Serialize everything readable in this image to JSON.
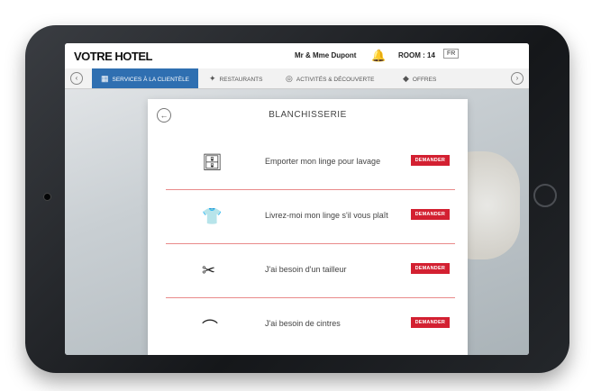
{
  "app": {
    "logo": "VOTRE HOTEL",
    "guest_name": "Mr & Mme Dupont",
    "room": "ROOM : 14",
    "language": "FR"
  },
  "nav": {
    "tabs": [
      {
        "label": "SERVICES À LA CLIENTÈLE",
        "icon": "building-icon"
      },
      {
        "label": "RESTAURANTS",
        "icon": "cutlery-icon"
      },
      {
        "label": "ACTIVITÉS & DÉCOUVERTE",
        "icon": "binoculars-icon"
      },
      {
        "label": "OFFRES",
        "icon": "tag-icon"
      }
    ]
  },
  "panel": {
    "title": "BLANCHISSERIE",
    "items": [
      {
        "text": "Emporter mon linge pour lavage",
        "button": "DEMANDER",
        "icon": "washing-machine-icon"
      },
      {
        "text": "Livrez-moi mon linge s'il vous plaît",
        "button": "DEMANDER",
        "icon": "shirt-bag-icon"
      },
      {
        "text": "J'ai besoin d'un tailleur",
        "button": "DEMANDER",
        "icon": "needle-thread-icon"
      },
      {
        "text": "J'ai besoin de cintres",
        "button": "DEMANDER",
        "icon": "hanger-icon"
      }
    ]
  }
}
